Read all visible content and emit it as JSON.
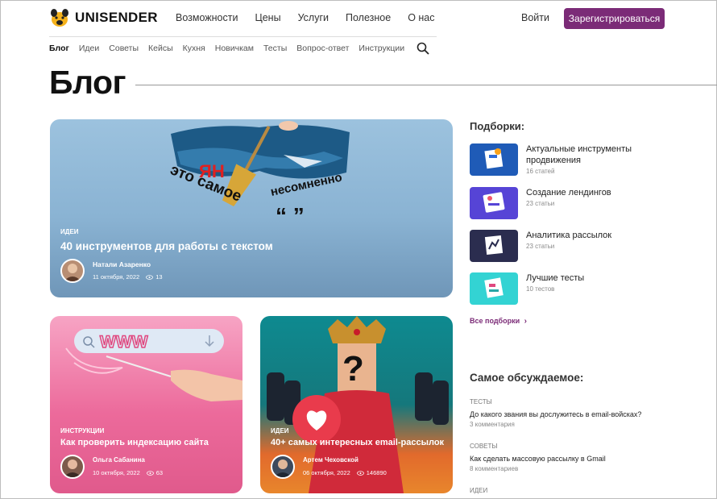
{
  "header": {
    "logo_text": "UNISENDER",
    "nav": [
      "Возможности",
      "Цены",
      "Услуги",
      "Полезное",
      "О нас"
    ],
    "login": "Войти",
    "register": "Зарегистрироваться",
    "subnav": [
      "Блог",
      "Идеи",
      "Советы",
      "Кейсы",
      "Кухня",
      "Новичкам",
      "Тесты",
      "Вопрос-ответ",
      "Инструкции"
    ]
  },
  "page_title": "Блог",
  "featured": {
    "tag": "идеи",
    "title": "40 инструментов для работы с текстом",
    "author": "Натали Азаренко",
    "date": "11 октября, 2022",
    "views": "13",
    "art_words": [
      "это самое",
      "несомненно",
      "“ ”"
    ]
  },
  "cards": [
    {
      "tag": "инструкции",
      "title": "Как проверить индексацию сайта",
      "author": "Ольга Сабанина",
      "date": "10 октября, 2022",
      "views": "63",
      "art_text": "WWW"
    },
    {
      "tag": "идеи",
      "title": "40+ самых интересных email-рассылок",
      "author": "Артем Чеховской",
      "date": "06 октября, 2022",
      "views": "146890",
      "art_text": "?"
    }
  ],
  "collections": {
    "heading": "Подборки:",
    "items": [
      {
        "title": "Актуальные инструменты продвижения",
        "count": "16 статей",
        "color": "#1f5bb7"
      },
      {
        "title": "Создание лендингов",
        "count": "23 статьи",
        "color": "#5644d6"
      },
      {
        "title": "Аналитика рассылок",
        "count": "23 статьи",
        "color": "#2b2d4f"
      },
      {
        "title": "Лучшие тесты",
        "count": "10 тестов",
        "color": "#33d3d3"
      }
    ],
    "all_label": "Все подборки"
  },
  "discussed": {
    "heading": "Самое обсуждаемое:",
    "items": [
      {
        "category": "тесты",
        "title": "До какого звания вы дослужитесь в email-войсках?",
        "count": "3 комментария"
      },
      {
        "category": "советы",
        "title": "Как сделать массовую рассылку в Gmail",
        "count": "8 комментариев"
      },
      {
        "category": "идеи",
        "title": "",
        "count": ""
      }
    ]
  },
  "colors": {
    "brand": "#7b2b77",
    "featured_bg": "#8fb7d6",
    "pink_card": "#e65b8e",
    "teal_card": "#0f8f91"
  }
}
